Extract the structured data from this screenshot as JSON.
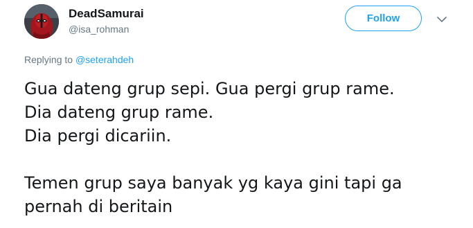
{
  "user": {
    "display_name": "DeadSamurai",
    "handle": "@isa_rohman",
    "avatar": "deadpool-avatar"
  },
  "follow_button": {
    "label": "Follow"
  },
  "menu": {
    "icon": "chevron-down-icon"
  },
  "reply": {
    "prefix": "Replying to",
    "target": "@seterahdeh"
  },
  "tweet": {
    "lines": [
      "Gua dateng grup sepi. Gua pergi grup rame.",
      "Dia dateng grup rame.",
      "Dia pergi dicariin.",
      "Temen grup saya banyak yg kaya gini tapi ga",
      "pernah di beritain"
    ]
  },
  "colors": {
    "accent": "#1da1f2",
    "text": "#14171a",
    "secondary": "#657786"
  }
}
